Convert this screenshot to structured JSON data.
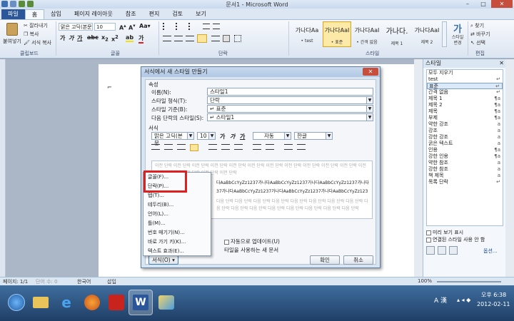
{
  "window": {
    "title": "문서1 - Microsoft Word"
  },
  "tabs": [
    "파일",
    "홈",
    "삽입",
    "페이지 레이아웃",
    "참조",
    "편지",
    "검토",
    "보기"
  ],
  "ribbon": {
    "paste_label": "붙여넣기",
    "cut": "잘라내기",
    "copy": "복사",
    "format_painter": "서식 복사",
    "clipboard_group": "클립보드",
    "font_name": "맑은 고딕(본문",
    "font_size": "10",
    "font_group": "글꼴",
    "paragraph_group": "단락",
    "styles_group": "스타일",
    "styles": [
      {
        "sample": "가나다Aa",
        "name": "• test"
      },
      {
        "sample": "가나다AaI",
        "name": "• 표준"
      },
      {
        "sample": "가나다AaI",
        "name": "• 간격 없음"
      },
      {
        "sample": "가나다.",
        "name": "제목 1"
      },
      {
        "sample": "가나다AaI",
        "name": "제목 2"
      }
    ],
    "change_styles": "스타일 변경",
    "find": "찾기",
    "replace": "바꾸기",
    "select": "선택",
    "editing_group": "편집"
  },
  "stylepane": {
    "title": "스타일",
    "items": [
      {
        "label": "모두 지우기",
        "mark": ""
      },
      {
        "label": "test",
        "mark": "↵"
      },
      {
        "label": "표준",
        "mark": "↵"
      },
      {
        "label": "간격 없음",
        "mark": "↵"
      },
      {
        "label": "제목 1",
        "mark": "¶a"
      },
      {
        "label": "제목 2",
        "mark": "¶a"
      },
      {
        "label": "제목",
        "mark": "¶a"
      },
      {
        "label": "부제",
        "mark": "¶a"
      },
      {
        "label": "약한 강조",
        "mark": "a"
      },
      {
        "label": "강조",
        "mark": "a"
      },
      {
        "label": "강한 강조",
        "mark": "a"
      },
      {
        "label": "굵은 텍스트",
        "mark": "a"
      },
      {
        "label": "인용",
        "mark": "¶a"
      },
      {
        "label": "강한 인용",
        "mark": "¶a"
      },
      {
        "label": "약한 참조",
        "mark": "a"
      },
      {
        "label": "강한 참조",
        "mark": "a"
      },
      {
        "label": "책 제목",
        "mark": "a"
      },
      {
        "label": "목록 단락",
        "mark": "↵"
      }
    ],
    "preview_label": "미리 보기 표시",
    "linked_label": "연결된 스타일 사용 안 함",
    "options": "옵션..."
  },
  "dialog": {
    "title": "서식에서 새 스타일 만들기",
    "section_props": "속성",
    "name_label": "이름(N):",
    "name_value": "스타일1",
    "type_label": "스타일 형식(T):",
    "type_value": "단락",
    "based_label": "스타일 기준(B):",
    "based_value": "↵ 표준",
    "next_label": "다음 단락의 스타일(S):",
    "next_value": "↵ 스타일1",
    "section_format": "서식",
    "font_value": "맑은 고딕(본문",
    "size_value": "10",
    "color_value": "자동",
    "lang_value": "한글",
    "preview_prev": "이전 단락 이전 단락 이전 단락 이전 단락 이전 단락 이전 단락 이전 단락 이전 단락 이전 단락 이전 단락 이전 단락 이전 단락 이전 단락 이전 단락 이전 단락 이전 단락",
    "preview_sample1": "다AaBbCcYyZz1237가나다AaBbCcYyZz1237가나다AaBbCcYyZz1237가나다",
    "preview_sample2": "37가나다AaBbCcYyZz1237가나다AaBbCcYyZz1237가나다AaBbCcYyZz123",
    "preview_next": "다음 단락 다음 단락 다음 단락 다음 단락 다음 단락 다음 단락 다음 단락 다음 단락 다음 단락 다음 단락 다음 단락 다음 단락 다음 단락 다음 단락 다음 단락 다음 단락",
    "auto_update": "자동으로 업데이트(U)",
    "new_doc_text": "타일을 사용하는 새 문서",
    "format_button": "서식(O) ▾",
    "ok": "확인",
    "cancel": "취소"
  },
  "format_menu": [
    "글꼴(F)...",
    "단락(P)...",
    "탭(T)...",
    "테두리(B)...",
    "언어(L)...",
    "틀(M)...",
    "번호 매기기(N)...",
    "바로 가기 키(K)...",
    "텍스트 효과(E)..."
  ],
  "statusbar": {
    "page": "페이지: 1/1",
    "words": "단어 수: 0",
    "language": "한국어",
    "mode": "삽입",
    "zoom": "100%"
  },
  "taskbar": {
    "ime": "A 漢",
    "time": "오후 6:38",
    "date": "2012-02-11"
  }
}
